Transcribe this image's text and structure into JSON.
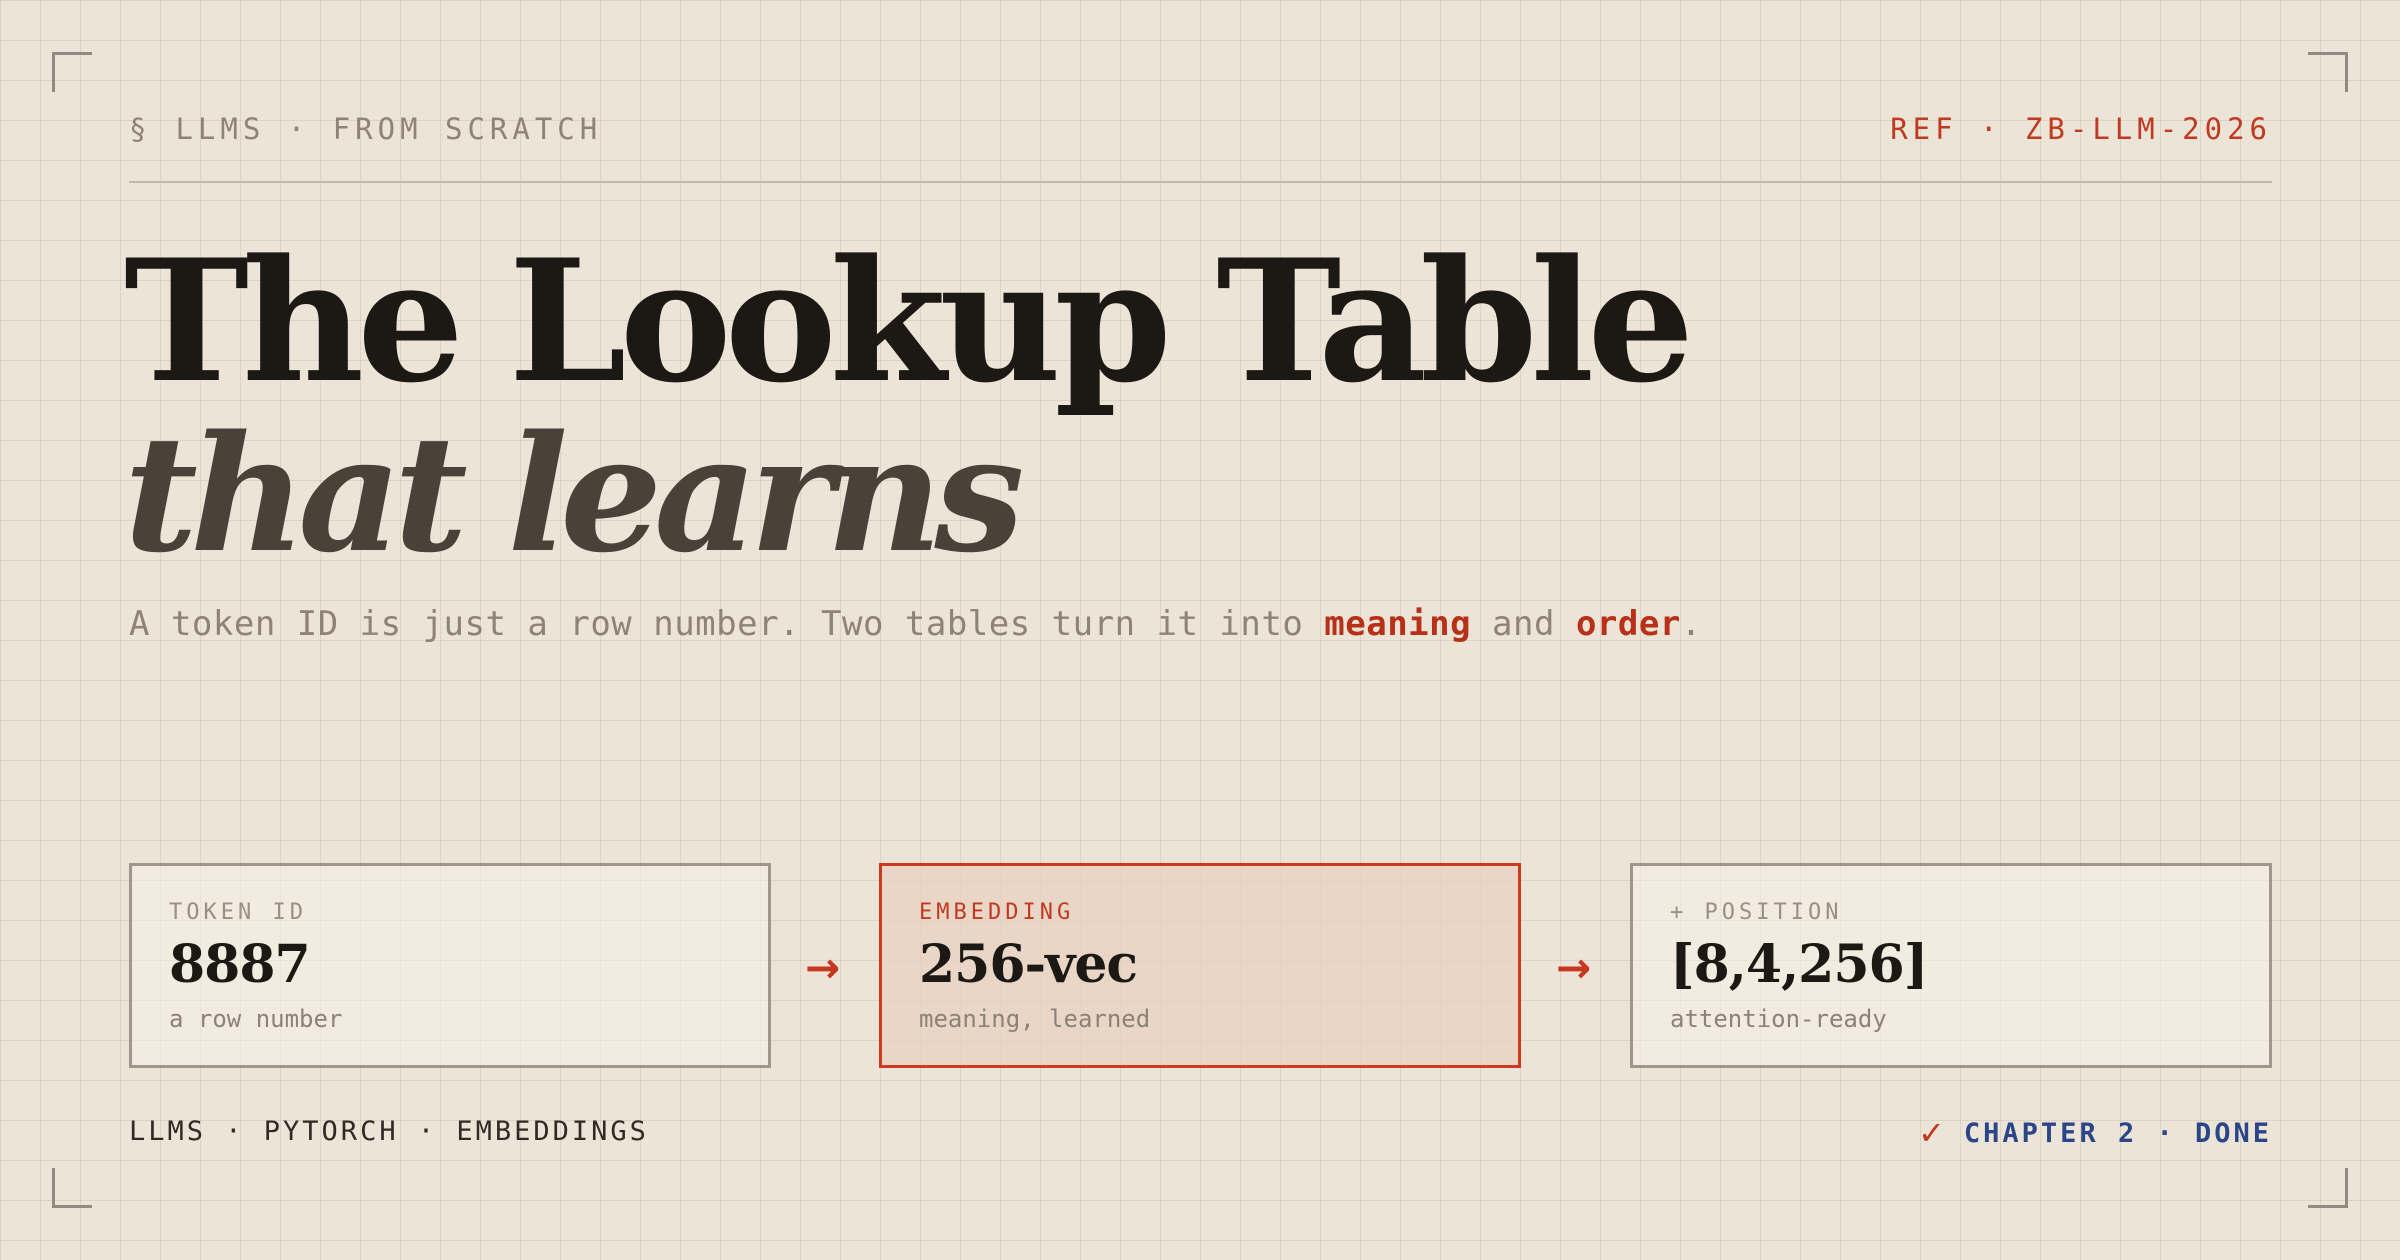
{
  "header": {
    "section_mark": "§",
    "series": "LLMS · FROM SCRATCH",
    "ref": "REF · ZB-LLM-2026"
  },
  "title": {
    "line1": "The Lookup Table",
    "line2": "that learns"
  },
  "subtitle": {
    "prefix": "A token ID is just a row number. Two tables turn it into ",
    "highlight1": "meaning",
    "middle": " and ",
    "highlight2": "order",
    "suffix": "."
  },
  "cards": [
    {
      "label": "TOKEN ID",
      "value": "8887",
      "sub": "a row number"
    },
    {
      "label": "EMBEDDING",
      "value": "256-vec",
      "sub": "meaning, learned"
    },
    {
      "label": "+ POSITION",
      "value": "[8,4,256]",
      "sub": "attention-ready"
    }
  ],
  "arrows": [
    "→",
    "→"
  ],
  "footer": {
    "tags": "LLMS · PYTORCH · EMBEDDINGS",
    "check": "✓",
    "status": "CHAPTER 2 · DONE"
  },
  "colors": {
    "background": "#ece4d7",
    "accent": "#c03a22",
    "ink": "#1c1915",
    "muted": "#8f8376",
    "status_blue": "#2a4588"
  }
}
